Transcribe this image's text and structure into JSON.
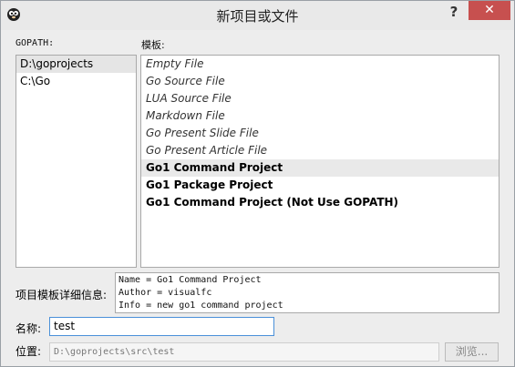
{
  "window": {
    "title": "新项目或文件",
    "help_label": "?",
    "close_label": "✕"
  },
  "gopath": {
    "label": "GOPATH:",
    "items": [
      {
        "label": "D:\\goprojects",
        "selected": true
      },
      {
        "label": "C:\\Go",
        "selected": false
      }
    ]
  },
  "templates": {
    "label": "模板:",
    "items": [
      {
        "label": "Empty File",
        "style": "italic"
      },
      {
        "label": "Go Source File",
        "style": "italic"
      },
      {
        "label": "LUA Source File",
        "style": "italic"
      },
      {
        "label": "Markdown File",
        "style": "italic"
      },
      {
        "label": "Go Present Slide File",
        "style": "italic"
      },
      {
        "label": "Go Present Article File",
        "style": "italic"
      },
      {
        "label": "Go1 Command Project",
        "style": "bold",
        "selected": true
      },
      {
        "label": "Go1 Package Project",
        "style": "bold"
      },
      {
        "label": "Go1 Command Project (Not Use GOPATH)",
        "style": "bold"
      }
    ]
  },
  "details": {
    "label": "项目模板详细信息:",
    "lines": [
      "Name = Go1 Command Project",
      "Author = visualfc",
      "Info = new go1 command project"
    ]
  },
  "name_field": {
    "label": "名称:",
    "value": "test"
  },
  "location_field": {
    "label": "位置:",
    "value": "D:\\goprojects\\src\\test"
  },
  "browse_button": {
    "label": "浏览..."
  }
}
